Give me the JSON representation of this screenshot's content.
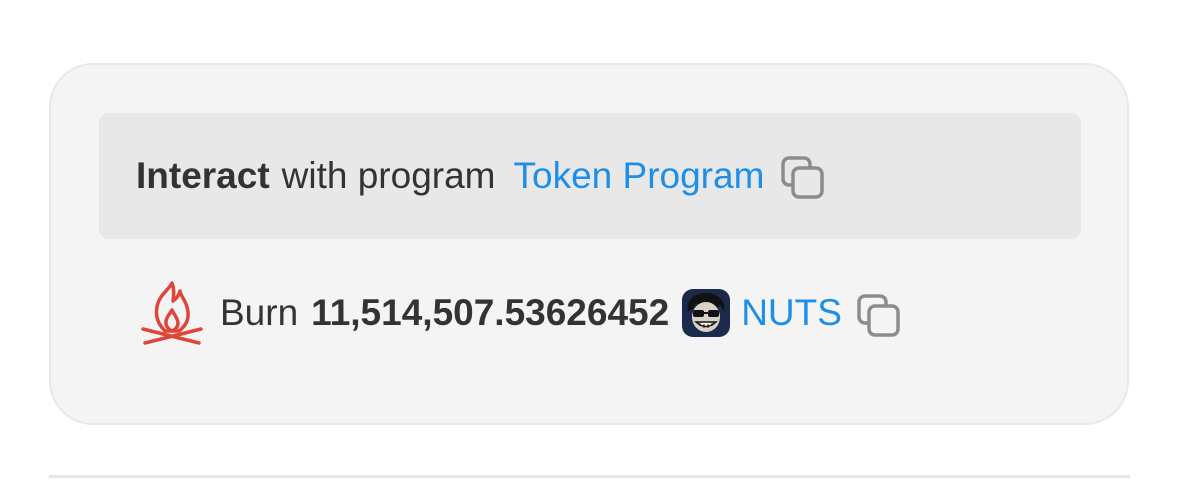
{
  "interaction": {
    "action_bold": "Interact",
    "action_rest": "with program",
    "program_name": "Token Program",
    "copy_icon": "copy-icon"
  },
  "instruction": {
    "icon": "fire-icon",
    "action": "Burn",
    "amount": "11,514,507.53626452",
    "token_avatar": "token-avatar",
    "token_symbol": "NUTS",
    "copy_icon": "copy-icon"
  },
  "colors": {
    "link": "#1e8fe8",
    "fire": "#e0453a",
    "card_background": "#f4f4f4",
    "header_background": "#e8e8e8",
    "text": "#333333"
  }
}
